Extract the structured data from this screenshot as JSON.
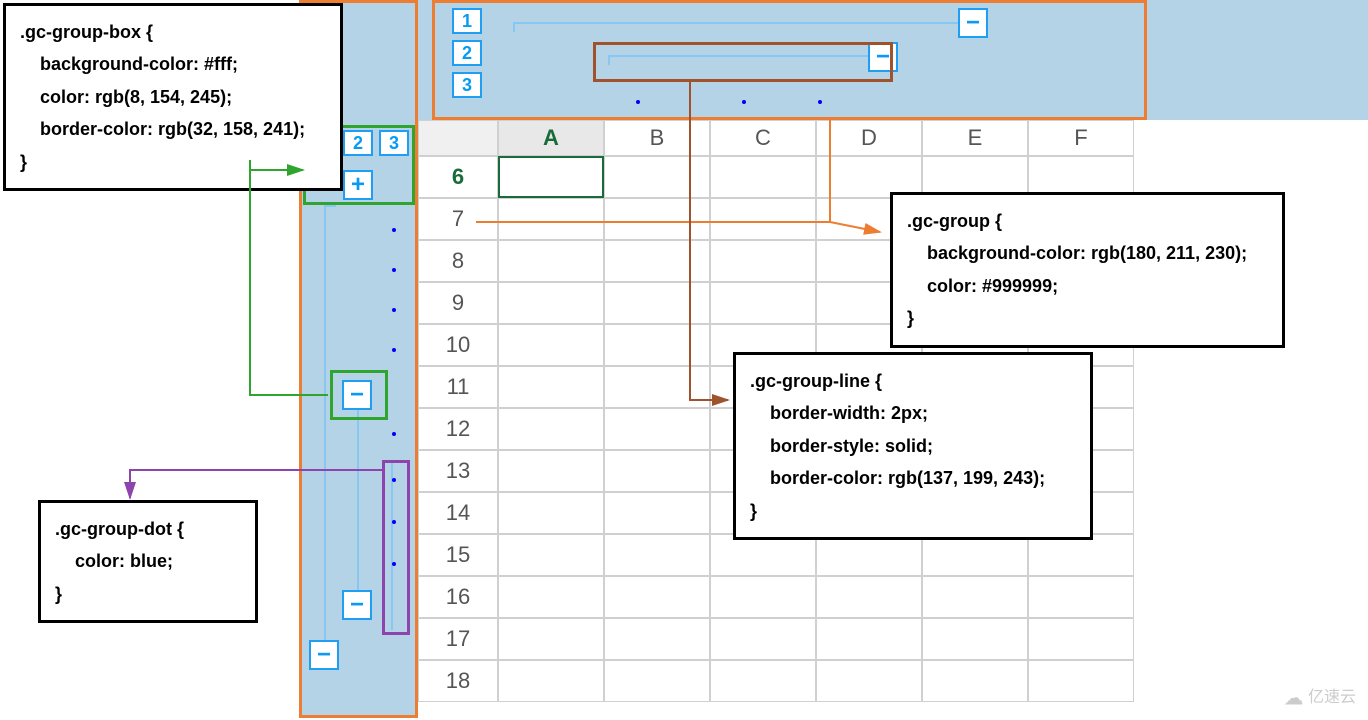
{
  "codeBoxes": {
    "groupBox": ".gc-group-box {\n    background-color: #fff;\n    color: rgb(8, 154, 245);\n    border-color: rgb(32, 158, 241);\n}",
    "group": ".gc-group {\n    background-color: rgb(180, 211, 230);\n    color: #999999;\n}",
    "groupLine": ".gc-group-line {\n    border-width: 2px;\n    border-style: solid;\n    border-color: rgb(137, 199, 243);\n}",
    "groupDot": ".gc-group-dot {\n    color: blue;\n}"
  },
  "rowLevels": [
    "1",
    "2",
    "3"
  ],
  "colLevels": [
    "1",
    "2",
    "3"
  ],
  "expand": {
    "plus": "+",
    "minus": "−"
  },
  "sheet": {
    "columns": [
      "A",
      "B",
      "C",
      "D",
      "E",
      "F"
    ],
    "rows": [
      "6",
      "7",
      "8",
      "9",
      "10",
      "11",
      "12",
      "13",
      "14",
      "15",
      "16",
      "17",
      "18"
    ],
    "activeCol": "A",
    "activeRow": "6"
  },
  "watermark": "亿速云"
}
